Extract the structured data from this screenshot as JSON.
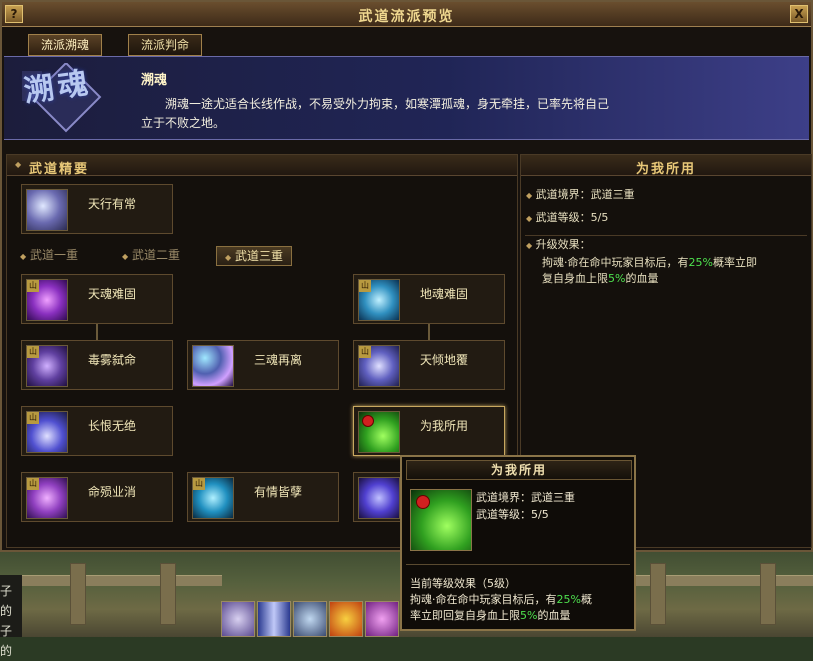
{
  "window": {
    "title": "武道流派预览",
    "help_label": "?",
    "close_label": "X"
  },
  "tabs": [
    {
      "label": "流派溯魂"
    },
    {
      "label": "流派判命"
    }
  ],
  "school": {
    "emblem_text": "溯魂",
    "name": "溯魂",
    "description": "溯魂一途尤适合长线作战，不易受外力拘束，如寒潭孤魂，身无牵挂，已率先将自己立于不败之地。"
  },
  "left_panel": {
    "title": "武道精要",
    "core_skill": {
      "label": "天行有常"
    },
    "subtabs": [
      {
        "label": "武道一重"
      },
      {
        "label": "武道二重"
      },
      {
        "label": "武道三重"
      }
    ],
    "skills": [
      {
        "label": "天魂难固",
        "badge": "山"
      },
      {
        "label": "地魂难固",
        "badge": "山"
      },
      {
        "label": "毒雾弑命",
        "badge": "山"
      },
      {
        "label": "三魂再离",
        "badge": ""
      },
      {
        "label": "天倾地覆",
        "badge": "山"
      },
      {
        "label": "长恨无绝",
        "badge": "山"
      },
      {
        "label": "为我所用",
        "badge": ""
      },
      {
        "label": "命殒业消",
        "badge": "山"
      },
      {
        "label": "有情皆孽",
        "badge": "山"
      }
    ]
  },
  "right_panel": {
    "title": "为我所用",
    "realm_label": "武道境界：",
    "realm_value": "武道三重",
    "level_label": "武道等级：",
    "level_value": "5/5",
    "upgrade_label": "升级效果：",
    "upgrade_line1_a": "拘魂·命在命中玩家目标后，有",
    "upgrade_line1_pct": "25%",
    "upgrade_line1_b": "概率立即",
    "upgrade_line2_a": "复自身血上限",
    "upgrade_line2_pct": "5%",
    "upgrade_line2_b": "的血量"
  },
  "tooltip": {
    "title": "为我所用",
    "realm_label": "武道境界：",
    "realm_value": "武道三重",
    "level_label": "武道等级：",
    "level_value": "5/5",
    "current_label": "当前等级效果（5级）",
    "effect_line1_a": "拘魂·命在命中玩家目标后，有",
    "effect_line1_pct": "25%",
    "effect_line1_b": "概",
    "effect_line2_a": "率立即回复自身血上限",
    "effect_line2_pct": "5%",
    "effect_line2_b": "的血量"
  },
  "background": {
    "chat_line1": "子的",
    "chat_line2": "子的"
  },
  "colors": {
    "accent_gold": "#e8c878",
    "highlight_green": "#4ee04e",
    "banner_blue": "#202556"
  }
}
